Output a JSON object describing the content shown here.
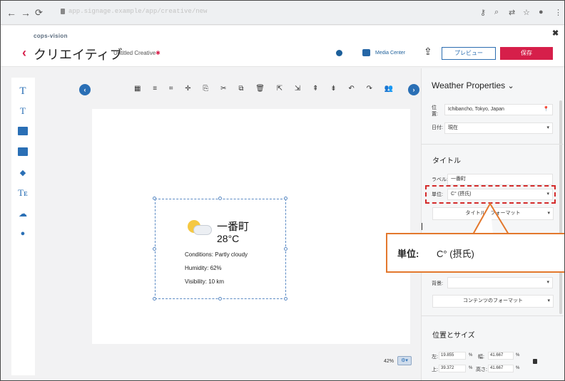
{
  "browser": {
    "url": "app.signage.example/app/creative/new",
    "icons": [
      "back-icon",
      "forward-icon",
      "reload-icon",
      "lock-icon",
      "key-icon",
      "zoom-icon",
      "translate-icon",
      "star-icon",
      "profile-icon",
      "menu-icon"
    ]
  },
  "header": {
    "logo": "cops-vision",
    "close": "✖",
    "back_glyph": "‹",
    "title": "クリエイティブ",
    "subtitle": "Untitled Creative",
    "subtitle_mark": "✱",
    "media_center": "Media Center",
    "preview": "プレビュー",
    "save": "保存"
  },
  "toolbar": {
    "left_collapse": "‹",
    "right_collapse": "›",
    "tools": "▦ ≡ ⌗ ✛  ⎘ ✂ ⧉ 🗑  ⇱ ⇲ ⇞ ⇟  ↶ ↷  👥"
  },
  "left_tools": {
    "text": "T",
    "textframe": "T",
    "weather": "☁"
  },
  "widget": {
    "city": "一番町",
    "temp": "28°C",
    "conditions": "Conditions: Partly cloudy",
    "humidity": "Humidity: 62%",
    "visibility": "Visibility: 10 km"
  },
  "zoom": {
    "value": "42%",
    "button": "⚙▾"
  },
  "panel": {
    "title": "Weather Properties",
    "title_caret": "⌄",
    "location_label": "位置:",
    "location_value": "Ichibancho, Tokyo, Japan",
    "location_pin": "📍",
    "date_label": "日付:",
    "date_value": "現在",
    "title_section": "タイトル",
    "label_label": "ラベル:",
    "label_value": "一番町",
    "unit_label": "単位:",
    "unit_value": "C° (摂氏)",
    "title_format": "タイトルのフォーマット",
    "background_label": "背景:",
    "content_format": "コンテンツのフォーマット",
    "possize_section": "位置とサイズ",
    "left_label": "左:",
    "left_value": "19.855",
    "left_unit": "%",
    "width_label": "幅:",
    "width_value": "41.667",
    "width_unit": "%",
    "top_label": "上:",
    "top_value": "39.372",
    "top_unit": "%",
    "height_label": "高さ:",
    "height_value": "41.667",
    "height_unit": "%",
    "caret": "▾"
  },
  "callout": {
    "label": "単位:",
    "value": "C° (摂氏)"
  },
  "colors": {
    "accent": "#2a6fb5",
    "brand_red": "#d61f4a",
    "callout_border": "#e3782d",
    "highlight_dash": "#d42a2a"
  }
}
